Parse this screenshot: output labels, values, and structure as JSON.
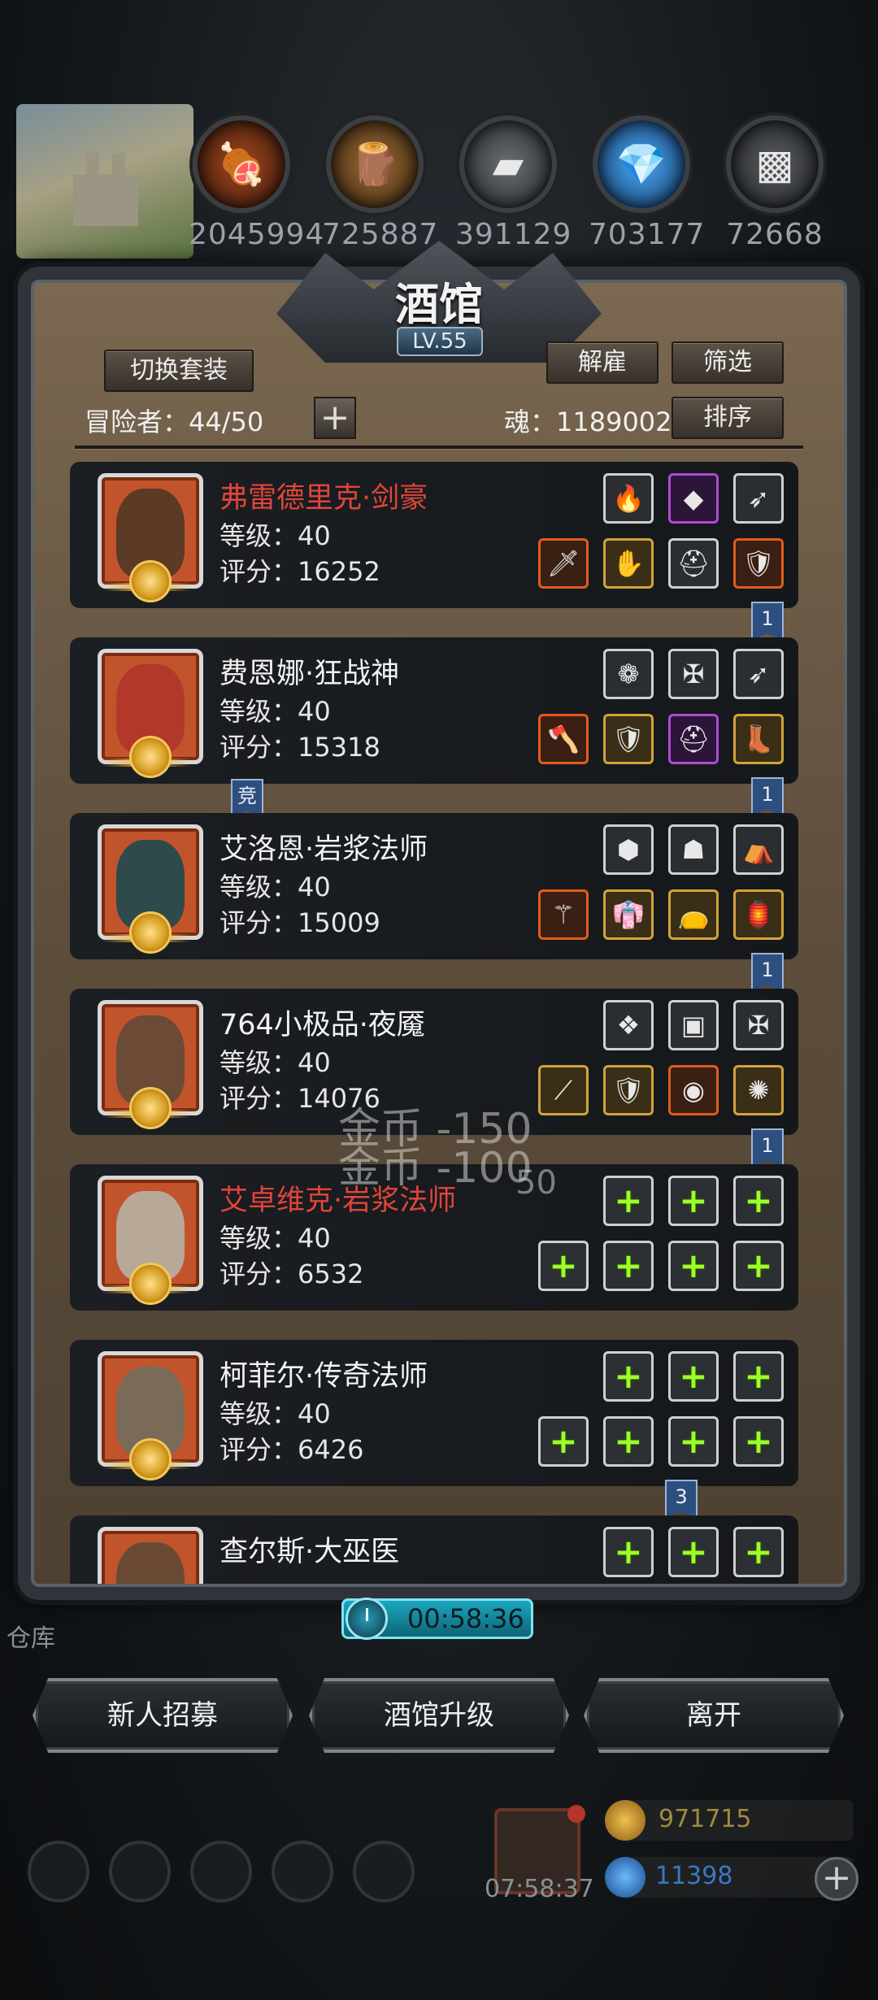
{
  "resources": [
    {
      "icon": "meat-icon",
      "value": "2045994",
      "color": "#8b3a1a"
    },
    {
      "icon": "wood-icon",
      "value": "725887",
      "color": "#8a5a2a"
    },
    {
      "icon": "iron-icon",
      "value": "391129",
      "color": "#555a5f"
    },
    {
      "icon": "crystal-icon",
      "value": "703177",
      "color": "#2a7ad0"
    },
    {
      "icon": "stone-icon",
      "value": "72668",
      "color": "#4a4d50"
    }
  ],
  "panel": {
    "title": "酒馆",
    "level": "LV.55",
    "switch_outfit": "切换套装",
    "dismiss": "解雇",
    "filter": "筛选",
    "sort": "排序",
    "adventurers": "冒险者：44/50",
    "soul": "魂：1189002"
  },
  "heroes": [
    {
      "name": "弗雷德里克·剑豪",
      "level": "等级：40",
      "score": "评分：16252",
      "name_color": "red",
      "face": "#5b3a26"
    },
    {
      "name": "费恩娜·狂战神",
      "level": "等级：40",
      "score": "评分：15318",
      "name_color": "white",
      "face": "#b2382a"
    },
    {
      "name": "艾洛恩·岩浆法师",
      "level": "等级：40",
      "score": "评分：15009",
      "name_color": "white",
      "face": "#2f4a4a"
    },
    {
      "name": "764小极品·夜魇",
      "level": "等级：40",
      "score": "评分：14076",
      "name_color": "white",
      "face": "#6b4a36"
    },
    {
      "name": "艾卓维克·岩浆法师",
      "level": "等级：40",
      "score": "评分：6532",
      "name_color": "red",
      "face": "#b8a898"
    },
    {
      "name": "柯菲尔·传奇法师",
      "level": "等级：40",
      "score": "评分：6426",
      "name_color": "white",
      "face": "#7a6a58"
    },
    {
      "name": "查尔斯·大巫医",
      "level": "",
      "score": "",
      "name_color": "white",
      "face": "#6a4a34"
    }
  ],
  "tags": {
    "rank_one": "1",
    "rank_three": "3",
    "compete": "竞"
  },
  "floating": {
    "gold_150": "金币 -150",
    "gold_100": "金币 -100",
    "faded": "50"
  },
  "timer": "00:58:36",
  "buttons": {
    "recruit": "新人招募",
    "upgrade": "酒馆升级",
    "leave": "离开"
  },
  "hud": {
    "gift_timer": "07:58:37",
    "gold": "971715",
    "gems": "11398",
    "warehouse": "仓库"
  }
}
